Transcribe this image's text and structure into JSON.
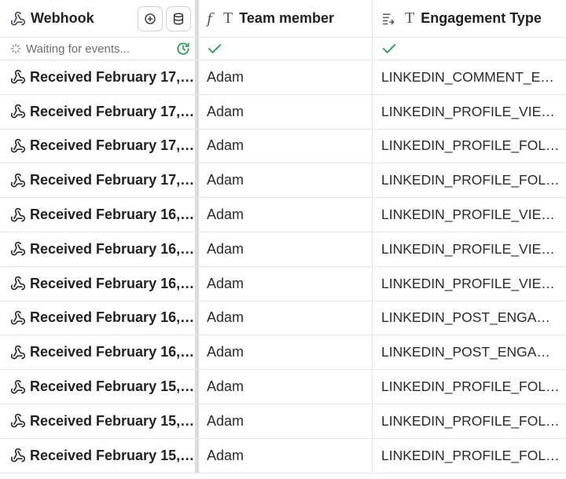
{
  "columns": {
    "webhook": {
      "label": "Webhook"
    },
    "team_member": {
      "label": "Team member"
    },
    "engagement_type": {
      "label": "Engagement Type"
    }
  },
  "status_row": {
    "text": "Waiting for events..."
  },
  "rows": [
    {
      "received": "Received February 17, ...",
      "member": "Adam",
      "type": "LINKEDIN_COMMENT_ENG..."
    },
    {
      "received": "Received February 17, ...",
      "member": "Adam",
      "type": "LINKEDIN_PROFILE_VIEWER"
    },
    {
      "received": "Received February 17, ...",
      "member": "Adam",
      "type": "LINKEDIN_PROFILE_FOLLO..."
    },
    {
      "received": "Received February 17, ...",
      "member": "Adam",
      "type": "LINKEDIN_PROFILE_FOLLO..."
    },
    {
      "received": "Received February 16, ...",
      "member": "Adam",
      "type": "LINKEDIN_PROFILE_VIEWER"
    },
    {
      "received": "Received February 16, ...",
      "member": "Adam",
      "type": "LINKEDIN_PROFILE_VIEWER"
    },
    {
      "received": "Received February 16, ...",
      "member": "Adam",
      "type": "LINKEDIN_PROFILE_VIEWER"
    },
    {
      "received": "Received February 16, ...",
      "member": "Adam",
      "type": "LINKEDIN_POST_ENGAGEM..."
    },
    {
      "received": "Received February 16, ...",
      "member": "Adam",
      "type": "LINKEDIN_POST_ENGAGEM..."
    },
    {
      "received": "Received February 15, ...",
      "member": "Adam",
      "type": "LINKEDIN_PROFILE_FOLLO..."
    },
    {
      "received": "Received February 15, ...",
      "member": "Adam",
      "type": "LINKEDIN_PROFILE_FOLLO..."
    },
    {
      "received": "Received February 15, ...",
      "member": "Adam",
      "type": "LINKEDIN_PROFILE_FOLLO..."
    }
  ],
  "colors": {
    "check": "#2e9e5b",
    "refresh": "#2e9e5b",
    "text": "#1f2023",
    "muted": "#6d6d74",
    "divider": "#dcdce0"
  }
}
